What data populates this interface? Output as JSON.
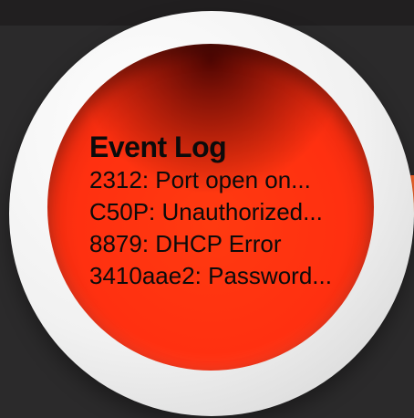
{
  "widget": {
    "title": "Event Log",
    "events": [
      {
        "text": "2312: Port open on..."
      },
      {
        "text": "C50P: Unauthorized..."
      },
      {
        "text": "8879: DHCP Error"
      },
      {
        "text": "3410aae2: Password..."
      }
    ]
  },
  "colors": {
    "background": "#2b2a2b",
    "accent": "#ff3a10",
    "ring": "#f1f1f1",
    "text": "#0b0b0b"
  }
}
